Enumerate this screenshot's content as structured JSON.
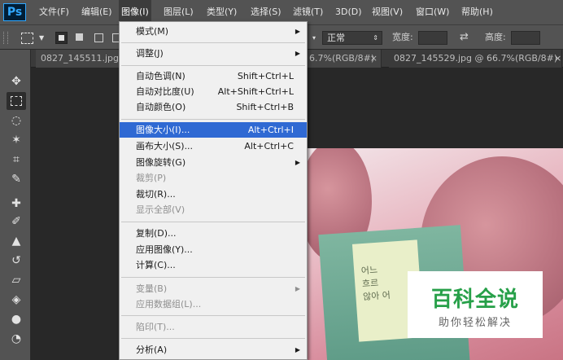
{
  "app": {
    "logo": "Ps"
  },
  "menubar": {
    "items": [
      {
        "label": "文件(F)"
      },
      {
        "label": "编辑(E)"
      },
      {
        "label": "图像(I)"
      },
      {
        "label": "图层(L)"
      },
      {
        "label": "类型(Y)"
      },
      {
        "label": "选择(S)"
      },
      {
        "label": "滤镜(T)"
      },
      {
        "label": "3D(D)"
      },
      {
        "label": "视图(V)"
      },
      {
        "label": "窗口(W)"
      },
      {
        "label": "帮助(H)"
      }
    ]
  },
  "options_bar": {
    "mode_value": "正常",
    "width_label": "宽度:",
    "height_label": "高度:"
  },
  "tabs": [
    {
      "label": "0827_145511.jpg",
      "partial": "6.7%(RGB/8#)"
    },
    {
      "label": "0827_145529.jpg @ 66.7%(RGB/8#)"
    }
  ],
  "image_menu": {
    "items": [
      {
        "label": "模式(M)",
        "shortcut": "",
        "submenu": true,
        "disabled": false
      },
      {
        "label": "调整(J)",
        "shortcut": "",
        "submenu": true,
        "disabled": false
      },
      {
        "label": "自动色调(N)",
        "shortcut": "Shift+Ctrl+L",
        "submenu": false,
        "disabled": false
      },
      {
        "label": "自动对比度(U)",
        "shortcut": "Alt+Shift+Ctrl+L",
        "submenu": false,
        "disabled": false
      },
      {
        "label": "自动颜色(O)",
        "shortcut": "Shift+Ctrl+B",
        "submenu": false,
        "disabled": false
      },
      {
        "label": "图像大小(I)...",
        "shortcut": "Alt+Ctrl+I",
        "submenu": false,
        "disabled": false,
        "highlighted": true
      },
      {
        "label": "画布大小(S)...",
        "shortcut": "Alt+Ctrl+C",
        "submenu": false,
        "disabled": false
      },
      {
        "label": "图像旋转(G)",
        "shortcut": "",
        "submenu": true,
        "disabled": false
      },
      {
        "label": "裁剪(P)",
        "shortcut": "",
        "submenu": false,
        "disabled": true
      },
      {
        "label": "裁切(R)...",
        "shortcut": "",
        "submenu": false,
        "disabled": false
      },
      {
        "label": "显示全部(V)",
        "shortcut": "",
        "submenu": false,
        "disabled": true
      },
      {
        "label": "复制(D)...",
        "shortcut": "",
        "submenu": false,
        "disabled": false
      },
      {
        "label": "应用图像(Y)...",
        "shortcut": "",
        "submenu": false,
        "disabled": false
      },
      {
        "label": "计算(C)...",
        "shortcut": "",
        "submenu": false,
        "disabled": false
      },
      {
        "label": "变量(B)",
        "shortcut": "",
        "submenu": true,
        "disabled": true
      },
      {
        "label": "应用数据组(L)...",
        "shortcut": "",
        "submenu": false,
        "disabled": true
      },
      {
        "label": "陷印(T)...",
        "shortcut": "",
        "submenu": false,
        "disabled": true
      },
      {
        "label": "分析(A)",
        "shortcut": "",
        "submenu": true,
        "disabled": false
      }
    ]
  },
  "canvas": {
    "book_text": [
      "어느",
      "흐르",
      "않아 어"
    ]
  },
  "watermark": {
    "title": "百科全说",
    "subtitle": "助你轻松解决"
  },
  "colors": {
    "menu_highlight": "#2f69d3",
    "watermark_green": "#27a049",
    "ps_blue": "#31a8ff"
  }
}
